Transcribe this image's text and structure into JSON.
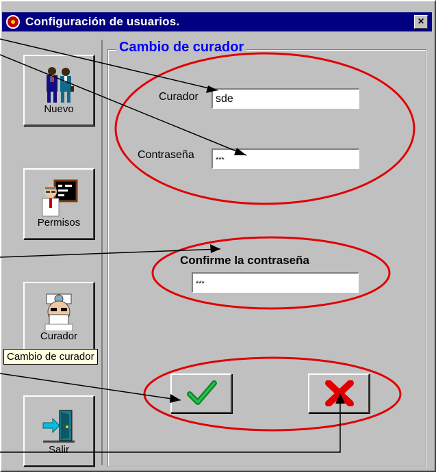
{
  "window": {
    "title": "Configuración de usuarios.",
    "close_label": "×"
  },
  "sidebar": {
    "buttons": [
      {
        "label": "Nuevo",
        "icon": "users-icon"
      },
      {
        "label": "Permisos",
        "icon": "teacher-board-icon"
      },
      {
        "label": "Curador",
        "icon": "doctor-icon"
      },
      {
        "label": "Salir",
        "icon": "exit-door-icon"
      }
    ]
  },
  "form": {
    "group_title": "Cambio de curador",
    "curador_label": "Curador",
    "curador_value": "sde",
    "password_label": "Contraseña",
    "password_value": "***",
    "confirm_label": "Confirme la contraseña",
    "confirm_value": "***"
  },
  "actions": {
    "accept_icon": "check-icon",
    "cancel_icon": "x-icon"
  },
  "tooltip": {
    "text": "Cambio de curador"
  },
  "colors": {
    "title_bar": "#000080",
    "group_title": "#0000ff",
    "annotation": "#e00000",
    "check": "#0a8a2a",
    "cross": "#e00000"
  }
}
